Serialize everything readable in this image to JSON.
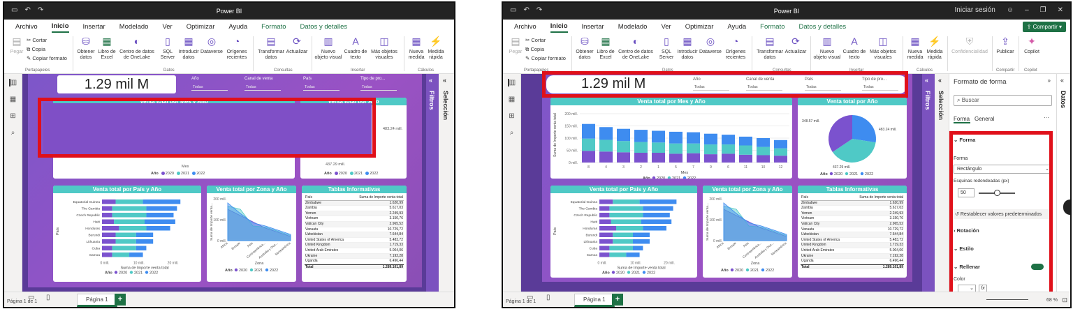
{
  "app_title": "Power BI",
  "signin": "Iniciar sesión",
  "tabs": [
    "Archivo",
    "Inicio",
    "Insertar",
    "Modelado",
    "Ver",
    "Optimizar",
    "Ayuda",
    "Formato",
    "Datos y detalles"
  ],
  "share_label": "Compartir",
  "ribbon": {
    "pegar": "Pegar",
    "cortar": "Cortar",
    "copia": "Copia",
    "copiar_formato": "Copiar formato",
    "portapapeles": "Portapapeles",
    "obtener": "Obtener datos",
    "libro": "Libro de Excel",
    "centro": "Centro de datos de OneLake",
    "sql": "SQL Server",
    "introducir": "Introducir datos",
    "dataverse": "Dataverse",
    "origenes": "Orígenes recientes",
    "datos_grp": "Datos",
    "transformar": "Transformar datos",
    "actualizar": "Actualizar",
    "consultas": "Consultas",
    "nuevo_objeto": "Nuevo objeto visual",
    "cuadro": "Cuadro de texto",
    "mas_objetos": "Más objetos visuales",
    "insertar_grp": "Insertar",
    "nueva_medida": "Nueva medida",
    "medida_rapida": "Medida rápida",
    "calculos": "Cálculos",
    "confidencialidad": "Confidencialidad",
    "publicar": "Publicar",
    "compartir": "Compartir",
    "copilot": "Copilot"
  },
  "report": {
    "kpi": "1.29 mil M",
    "slicers": [
      {
        "label": "Año",
        "value": "Todas"
      },
      {
        "label": "Canal de venta",
        "value": "Todas"
      },
      {
        "label": "País",
        "value": "Todas"
      },
      {
        "label": "Tipo de pro...",
        "value": "Todas"
      }
    ],
    "bar_title": "Venta total por Mes y Año",
    "bar_title_partial": "Venta total por Mes y Año",
    "pie_title": "Venta total por Año",
    "pie_title_partial": "Venta total por Año",
    "pie_labels": [
      "348.57 mill.",
      "483.24 mill.",
      "437.29 mill."
    ],
    "country_title": "Venta total por País y Año",
    "zone_title": "Venta total por Zona y Año",
    "tables_title": "Tablas Informativas",
    "mes_label": "Mes",
    "ano_label": "Año",
    "pais_label": "País",
    "zona_label": "Zona",
    "yaxis_bar": "Suma de Importe venta total",
    "yaxis_zone": "Suma de Importe venta...",
    "xaxis_country": "Suma de Importe venta total",
    "legend": [
      "2020",
      "2021",
      "2022"
    ],
    "bar_ticks": [
      "0 mill.",
      "50 mill.",
      "100 mill.",
      "150 mill.",
      "200 mill."
    ],
    "bar_months": [
      "8",
      "4",
      "3",
      "2",
      "1",
      "5",
      "7",
      "9",
      "6",
      "11",
      "10",
      "12"
    ],
    "country_ticks": [
      "0 mill.",
      "10 mill.",
      "20 mill."
    ],
    "zone_ticks": [
      "0 mill.",
      "100 mill.",
      "200 mill."
    ],
    "countries": [
      "Equatorial Guinea",
      "The Gambia",
      "Czech Republic",
      "Haiti",
      "Honduras",
      "Burundi",
      "Lithuania",
      "Cuba",
      "Samoa"
    ],
    "zones": [
      "Africa",
      "Europe",
      "Asia",
      "Centroamérica...",
      "Australia y Oce...",
      "Norteamérica"
    ],
    "table_header": [
      "País",
      "Suma de Importe venta total"
    ],
    "table_rows": [
      [
        "Zimbabwe",
        "1.620,99"
      ],
      [
        "Zambia",
        "5.617,03"
      ],
      [
        "Yemen",
        "2.249,93"
      ],
      [
        "Vietnam",
        "3.150,76"
      ],
      [
        "Vatican City",
        "2.965,52"
      ],
      [
        "Vanuatu",
        "10.729,72"
      ],
      [
        "Uzbekistan",
        "7.644,84"
      ],
      [
        "United States of America",
        "5.483,72"
      ],
      [
        "United Kingdom",
        "1.719,33"
      ],
      [
        "United Arab Emirates",
        "5.004,06"
      ],
      [
        "Ukraine",
        "7.192,28"
      ],
      [
        "Uganda",
        "6.496,44"
      ]
    ],
    "table_total": [
      "Total",
      "1.289.101,89"
    ]
  },
  "chart_data": [
    {
      "type": "bar",
      "title": "Venta total por Mes y Año",
      "xlabel": "Mes",
      "ylabel": "Suma de Importe venta total",
      "categories": [
        "8",
        "4",
        "3",
        "2",
        "1",
        "5",
        "7",
        "9",
        "6",
        "11",
        "10",
        "12"
      ],
      "ylim": [
        0,
        200
      ],
      "series": [
        {
          "name": "2020",
          "values": [
            48,
            45,
            42,
            40,
            40,
            36,
            38,
            34,
            36,
            32,
            30,
            28
          ]
        },
        {
          "name": "2021",
          "values": [
            50,
            48,
            46,
            44,
            42,
            42,
            40,
            40,
            38,
            38,
            34,
            30
          ]
        },
        {
          "name": "2022",
          "values": [
            60,
            52,
            50,
            50,
            48,
            48,
            46,
            44,
            40,
            36,
            36,
            34
          ]
        }
      ]
    },
    {
      "type": "pie",
      "title": "Venta total por Año",
      "series": [
        {
          "name": "2020",
          "values": [
            348.57
          ]
        },
        {
          "name": "2021",
          "values": [
            483.24
          ]
        },
        {
          "name": "2022",
          "values": [
            437.29
          ]
        }
      ]
    },
    {
      "type": "bar",
      "title": "Venta total por País y Año",
      "xlabel": "Suma de Importe venta total",
      "ylabel": "País",
      "categories": [
        "Equatorial Guinea",
        "The Gambia",
        "Czech Republic",
        "Haiti",
        "Honduras",
        "Burundi",
        "Lithuania",
        "Cuba",
        "Samoa"
      ],
      "xlim": [
        0,
        25
      ],
      "series": [
        {
          "name": "2020",
          "values": [
            4,
            3,
            3,
            3.5,
            5,
            4,
            4,
            3,
            3
          ]
        },
        {
          "name": "2021",
          "values": [
            8,
            10,
            10,
            9,
            8,
            6,
            6,
            7,
            5
          ]
        },
        {
          "name": "2022",
          "values": [
            11,
            9,
            8,
            9,
            7,
            5,
            5,
            3,
            4
          ]
        }
      ]
    },
    {
      "type": "area",
      "title": "Venta total por Zona y Año",
      "xlabel": "Zona",
      "ylabel": "Suma de Importe venta...",
      "categories": [
        "Africa",
        "Europe",
        "Asia",
        "Centroamérica...",
        "Australia y Oce...",
        "Norteamérica"
      ],
      "ylim": [
        0,
        200
      ],
      "series": [
        {
          "name": "2020",
          "values": [
            150,
            120,
            90,
            60,
            40,
            20
          ]
        },
        {
          "name": "2021",
          "values": [
            165,
            150,
            70,
            65,
            45,
            25
          ]
        },
        {
          "name": "2022",
          "values": [
            180,
            130,
            85,
            70,
            50,
            30
          ]
        }
      ]
    }
  ],
  "status": {
    "page": "Página 1 de 1",
    "page_tab": "Página 1",
    "zoom": "68 %"
  },
  "filters_label": "Filtros",
  "selection_label": "Selección",
  "format_pane": {
    "title": "Formato de forma",
    "search": "Buscar",
    "tab_forma": "Forma",
    "tab_general": "General",
    "sec_forma": "Forma",
    "forma_label": "Forma",
    "forma_value": "Rectángulo",
    "esquinas": "Esquinas redondeadas (px)",
    "esquinas_value": "50",
    "restablecer": "Restablecer valores predeterminados",
    "rotacion": "Rotación",
    "estilo": "Estilo",
    "rellenar": "Rellenar",
    "color": "Color"
  },
  "datos_label": "Datos"
}
